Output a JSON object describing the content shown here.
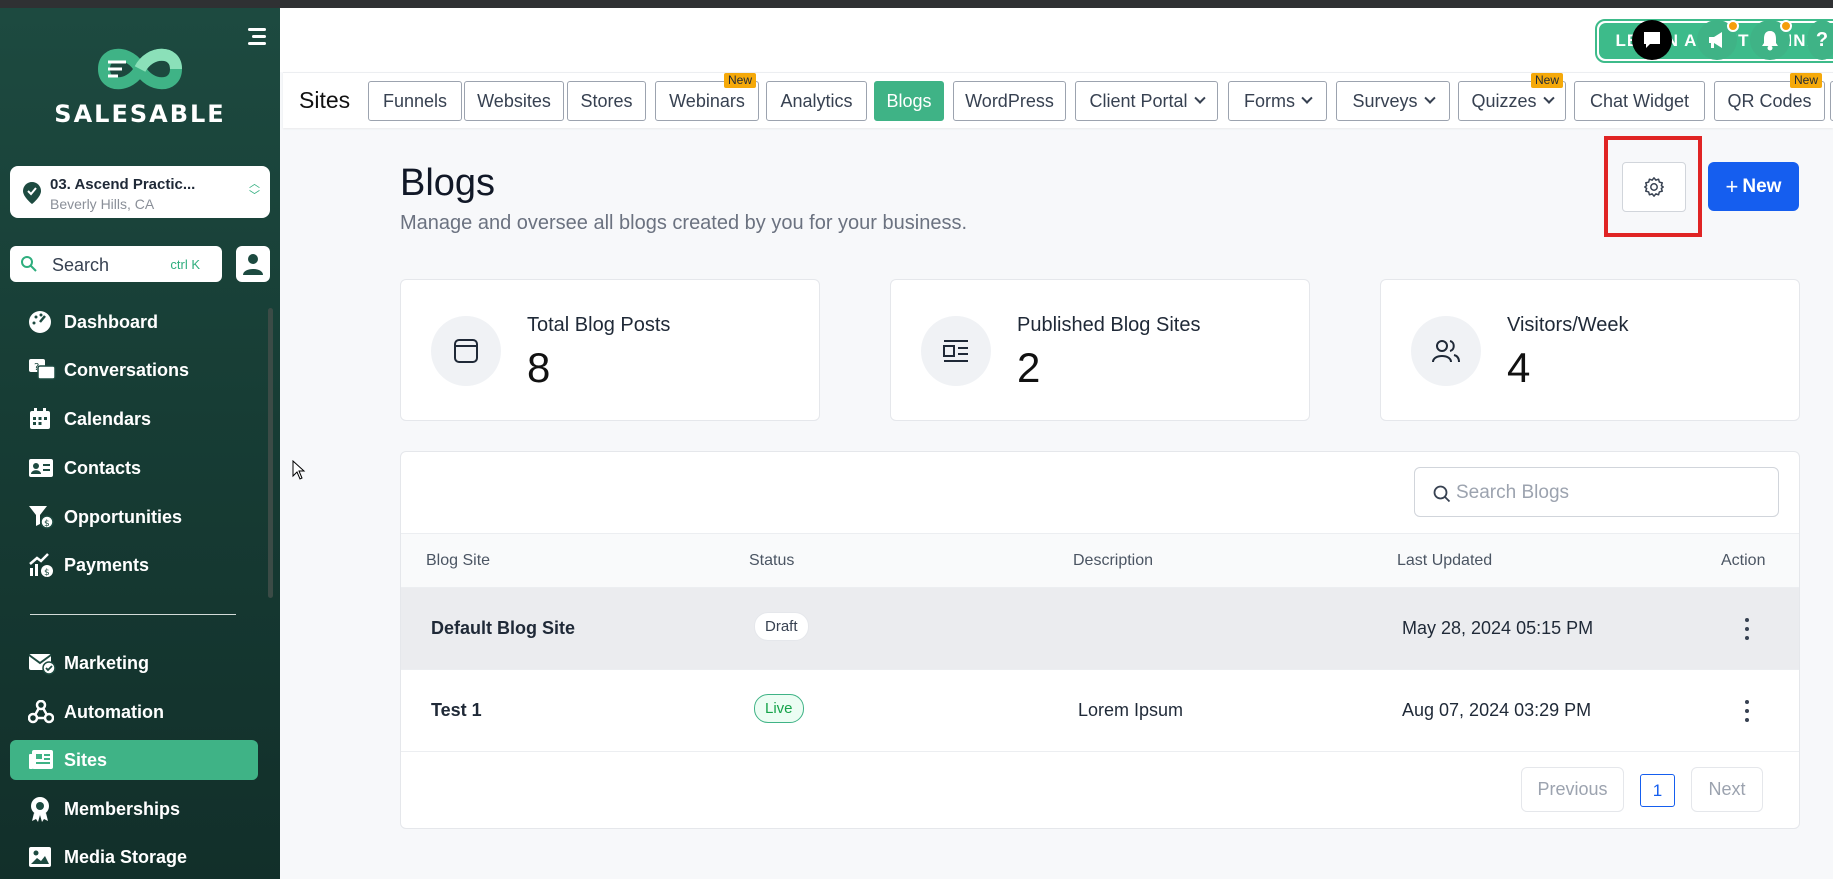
{
  "brand": {
    "name": "SALESABLE",
    "accent": "#3fb386",
    "primary_blue": "#155eef"
  },
  "location": {
    "name": "03. Ascend Practic...",
    "city": "Beverly Hills, CA"
  },
  "search": {
    "label": "Search",
    "shortcut": "ctrl K"
  },
  "sidebar": {
    "items": [
      {
        "label": "Dashboard",
        "icon": "dashboard-icon"
      },
      {
        "label": "Conversations",
        "icon": "conversations-icon"
      },
      {
        "label": "Calendars",
        "icon": "calendar-icon"
      },
      {
        "label": "Contacts",
        "icon": "contacts-icon"
      },
      {
        "label": "Opportunities",
        "icon": "opportunities-icon"
      },
      {
        "label": "Payments",
        "icon": "payments-icon"
      },
      {
        "label": "Marketing",
        "icon": "marketing-icon"
      },
      {
        "label": "Automation",
        "icon": "automation-icon"
      },
      {
        "label": "Sites",
        "icon": "sites-icon",
        "active": true
      },
      {
        "label": "Memberships",
        "icon": "memberships-icon"
      },
      {
        "label": "Media Storage",
        "icon": "media-icon"
      }
    ]
  },
  "header": {
    "learn_button": "LEARN ABOUT FUNNELS"
  },
  "tabs": {
    "title": "Sites",
    "items": [
      {
        "label": "Funnels"
      },
      {
        "label": "Websites"
      },
      {
        "label": "Stores"
      },
      {
        "label": "Webinars",
        "badge": "New"
      },
      {
        "label": "Analytics"
      },
      {
        "label": "Blogs",
        "active": true
      },
      {
        "label": "WordPress"
      },
      {
        "label": "Client Portal",
        "dropdown": true
      },
      {
        "label": "Forms",
        "dropdown": true
      },
      {
        "label": "Surveys",
        "dropdown": true
      },
      {
        "label": "Quizzes",
        "dropdown": true,
        "badge": "New"
      },
      {
        "label": "Chat Widget"
      },
      {
        "label": "QR Codes",
        "badge": "New"
      }
    ]
  },
  "page": {
    "title": "Blogs",
    "subtitle": "Manage and oversee all blogs created by you for your business.",
    "new_button": "New"
  },
  "stats": [
    {
      "label": "Total Blog Posts",
      "value": "8",
      "icon": "browser-window-icon"
    },
    {
      "label": "Published Blog Sites",
      "value": "2",
      "icon": "blog-layout-icon"
    },
    {
      "label": "Visitors/Week",
      "value": "4",
      "icon": "users-icon"
    }
  ],
  "table": {
    "search_placeholder": "Search Blogs",
    "columns": [
      "Blog Site",
      "Status",
      "Description",
      "Last Updated",
      "Action"
    ],
    "rows": [
      {
        "site": "Default Blog Site",
        "status": "Draft",
        "description": "",
        "updated": "May 28, 2024 05:15 PM"
      },
      {
        "site": "Test 1",
        "status": "Live",
        "description": "Lorem Ipsum",
        "updated": "Aug 07, 2024 03:29 PM"
      }
    ],
    "pagination": {
      "previous": "Previous",
      "current": "1",
      "next": "Next"
    }
  }
}
